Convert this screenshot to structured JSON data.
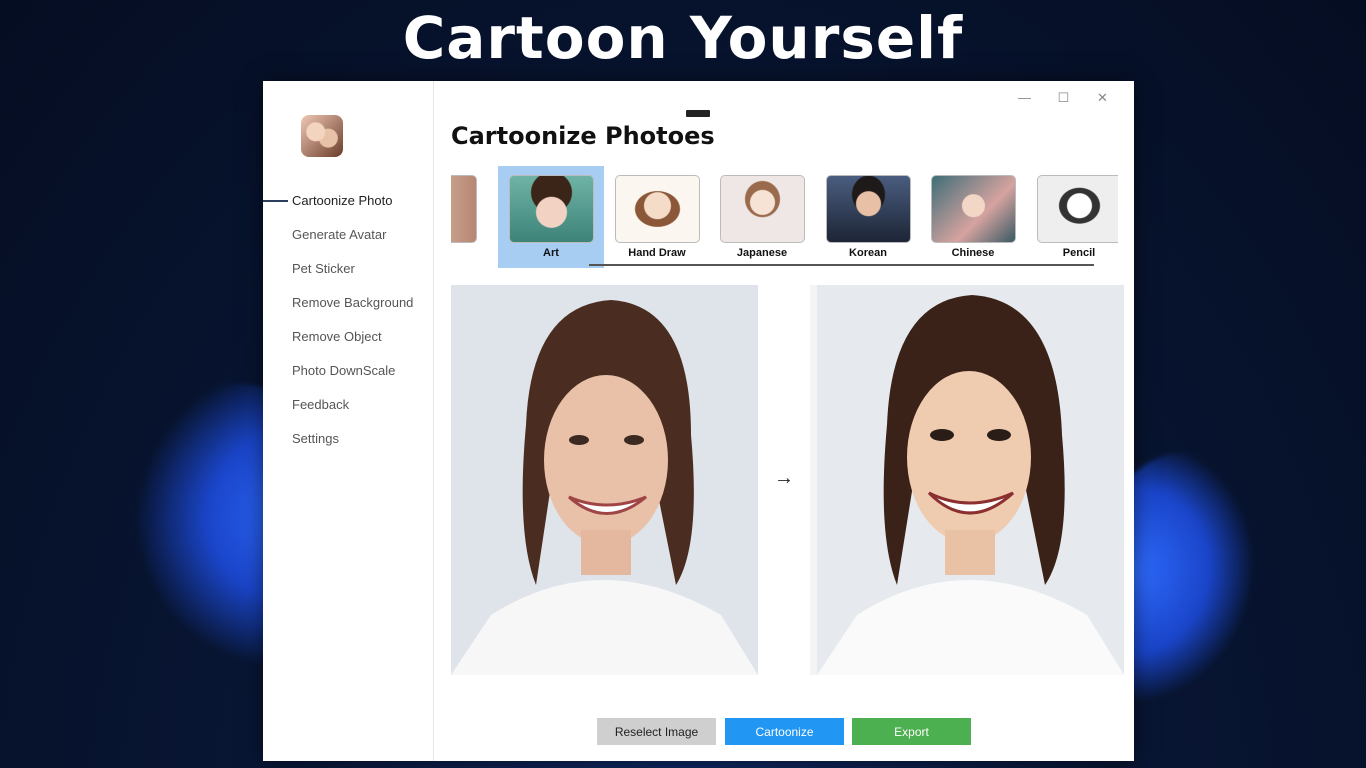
{
  "banner": {
    "title": "Cartoon Yourself"
  },
  "window": {
    "controls": {
      "minimize": "—",
      "maximize": "☐",
      "close": "✕"
    }
  },
  "sidebar": {
    "items": [
      {
        "label": "Cartoonize Photo",
        "active": true
      },
      {
        "label": "Generate Avatar"
      },
      {
        "label": "Pet Sticker"
      },
      {
        "label": "Remove Background"
      },
      {
        "label": "Remove Object"
      },
      {
        "label": "Photo DownScale"
      },
      {
        "label": "Feedback"
      },
      {
        "label": "Settings"
      }
    ]
  },
  "main": {
    "title": "Cartoonize Photoes",
    "styles": [
      {
        "label": ""
      },
      {
        "label": "Art",
        "selected": true
      },
      {
        "label": "Hand Draw"
      },
      {
        "label": "Japanese"
      },
      {
        "label": "Korean"
      },
      {
        "label": "Chinese"
      },
      {
        "label": "Pencil"
      }
    ],
    "arrow": "→"
  },
  "actions": {
    "reselect": "Reselect Image",
    "cartoonize": "Cartoonize",
    "export": "Export"
  },
  "colors": {
    "cartoonize_button": "#2196f3",
    "export_button": "#4caf50",
    "reselect_button": "#cfcfcf",
    "selected_style": "#a8cdf2"
  }
}
